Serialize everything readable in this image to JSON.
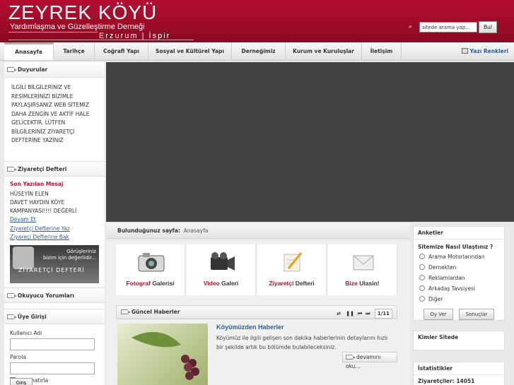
{
  "header": {
    "title": "ZEYREK KÖYÜ",
    "subtitle": "Yardımlaşma ve Güzelleştirme Derneği",
    "location": "Erzurum | İspir",
    "search_value": "sitede arama yap...",
    "search_button": "Bul"
  },
  "nav": {
    "items": [
      "Anasayfa",
      "Tarihçe",
      "Coğrafi Yapı",
      "Sosyal ve Kültürel Yapı",
      "Derneğimiz",
      "Kurum ve Kuruluşlar",
      "İletişim"
    ],
    "colors_label": "Yazı Renkleri"
  },
  "left": {
    "announcements_title": "Duyurular",
    "announcements_text": "İLGİLİ BİLGİLERİNİZ VE\nRESİMLERİNİZİ BİZİMLE\nPAYLAŞIRSANIZ WEB SİTEMİZ\nDAHA ZENGİN VE AKTİF HALE\nGELİCEKTİR. LÜTFEN\nBİLGİLERİNİZ ZİYARETÇİ\nDEFTERİNE YAZINIZ",
    "guestbook_title": "Ziyaretçi Defteri",
    "last_message_label": "Son Yazılan Mesaj",
    "last_message_author": "HÜSEYİN ELEN",
    "last_message_text": "DAVET HAYDIN KÖYE KAMPANYASI!!!! DEĞERLİ",
    "read_more": "Devam Et",
    "write_link": "Ziyaretçi Defterine Yaz",
    "view_link": "Ziyareçi Defterine Bak",
    "banner_text1": "Görüşleriniz\nbizim için değerlidir...",
    "banner_text2": "ZİYARETÇİ DEFTERİ",
    "comments_title": "Okuyucu Yorumları",
    "login_title": "Üye Girişi",
    "username_label": "Kullanıcı Adı",
    "password_label": "Parola",
    "remember_label": "Beni hatırla",
    "login_button": "Giriş"
  },
  "breadcrumb": {
    "label": "Bulunduğunuz sayfa:",
    "current": "Anasayfa"
  },
  "quick_links": [
    {
      "first": "Fotograf",
      "second": " Galerisi"
    },
    {
      "first": "Video",
      "second": " Galeri"
    },
    {
      "first": "Ziyaretçi",
      "second": " Defteri"
    },
    {
      "first": "Bize",
      "second": " Ulasin!"
    }
  ],
  "news": {
    "section_title": "Güncel Haberler",
    "page": "1/11",
    "item_title": "Köyümüzden Haberler",
    "item_text": "Köyümüz ile ilgili gelişen son dakika haberlerinin detaylarını hızlı bir şekilde artık bu bölümde bulabileceksiniz.",
    "more": "devamını oku..."
  },
  "poll": {
    "title": "Anketler",
    "question": "Sitemize Nasıl Ulaştınız ?",
    "options": [
      "Arama Motorlarından",
      "Dernekten",
      "Reklamlardan",
      "Arkadaş Tavsiyesi",
      "Diğer"
    ],
    "vote_button": "Oy Ver",
    "results_button": "Sonuçlar"
  },
  "online": {
    "title": "Kimler Sitede"
  },
  "stats": {
    "title": "İstatistikler",
    "visitors": "Ziyaretçiler: 14051"
  },
  "colors": {
    "brand": "#a30d2c",
    "link": "#2a5c9a"
  }
}
